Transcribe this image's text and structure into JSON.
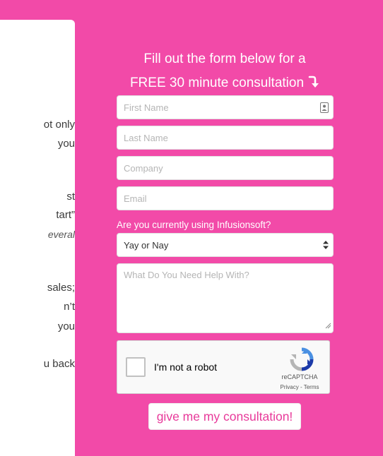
{
  "colors": {
    "background": "#f24aa8",
    "accent_text": "#e8399a",
    "white": "#ffffff"
  },
  "left_panel": {
    "lines": [
      "ot only",
      "you",
      "st",
      "tart”",
      "everal",
      "sales;",
      "n’t",
      "you",
      "u back"
    ]
  },
  "form": {
    "heading_line1": "Fill out the form below for a",
    "heading_line2": "FREE 30 minute consultation",
    "heading_arrow_icon": "curved-down-arrow-icon",
    "fields": {
      "first_name": "First Name",
      "last_name": "Last Name",
      "company": "Company",
      "email": "Email"
    },
    "contact_card_icon": "contact-card-icon",
    "question": "Are you currently using Infusionsoft?",
    "select_value": "Yay or Nay",
    "textarea_placeholder": "What Do You Need Help With?",
    "captcha": {
      "label": "I'm not a robot",
      "brand": "reCAPTCHA",
      "terms": "Privacy - Terms"
    },
    "submit_label": "give me my consultation!"
  }
}
